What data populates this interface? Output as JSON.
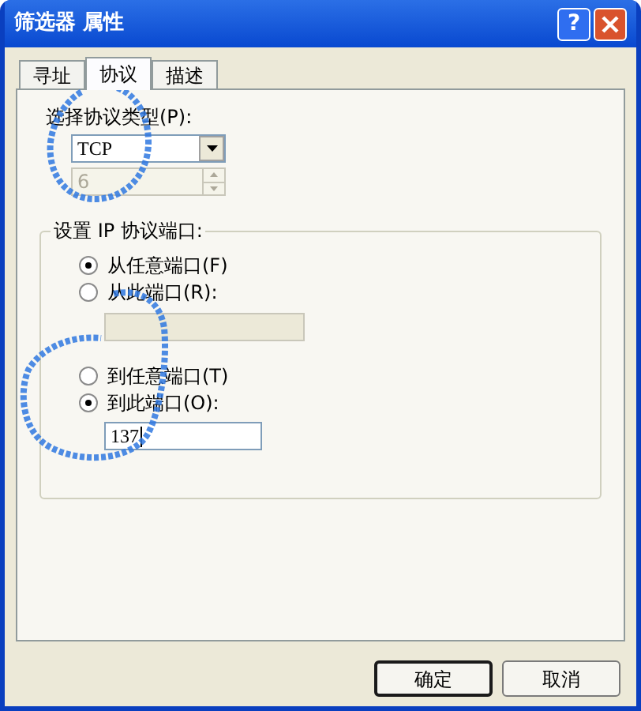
{
  "window": {
    "title": "筛选器 属性",
    "help_label": "?"
  },
  "tabs": [
    {
      "label": "寻址",
      "selected": false
    },
    {
      "label": "协议",
      "selected": true
    },
    {
      "label": "描述",
      "selected": false
    }
  ],
  "protocol": {
    "label": "选择协议类型(P):",
    "value": "TCP",
    "number": "6"
  },
  "port_group": {
    "title": "设置 IP 协议端口:",
    "from": [
      {
        "label": "从任意端口(F)",
        "selected": true
      },
      {
        "label": "从此端口(R):",
        "selected": false
      }
    ],
    "from_value_disabled": true,
    "to": [
      {
        "label": "到任意端口(T)",
        "selected": false
      },
      {
        "label": "到此端口(O):",
        "selected": true
      }
    ],
    "to_value": "137"
  },
  "buttons": [
    {
      "label": "确定",
      "default": true
    },
    {
      "label": "取消",
      "default": false
    }
  ]
}
